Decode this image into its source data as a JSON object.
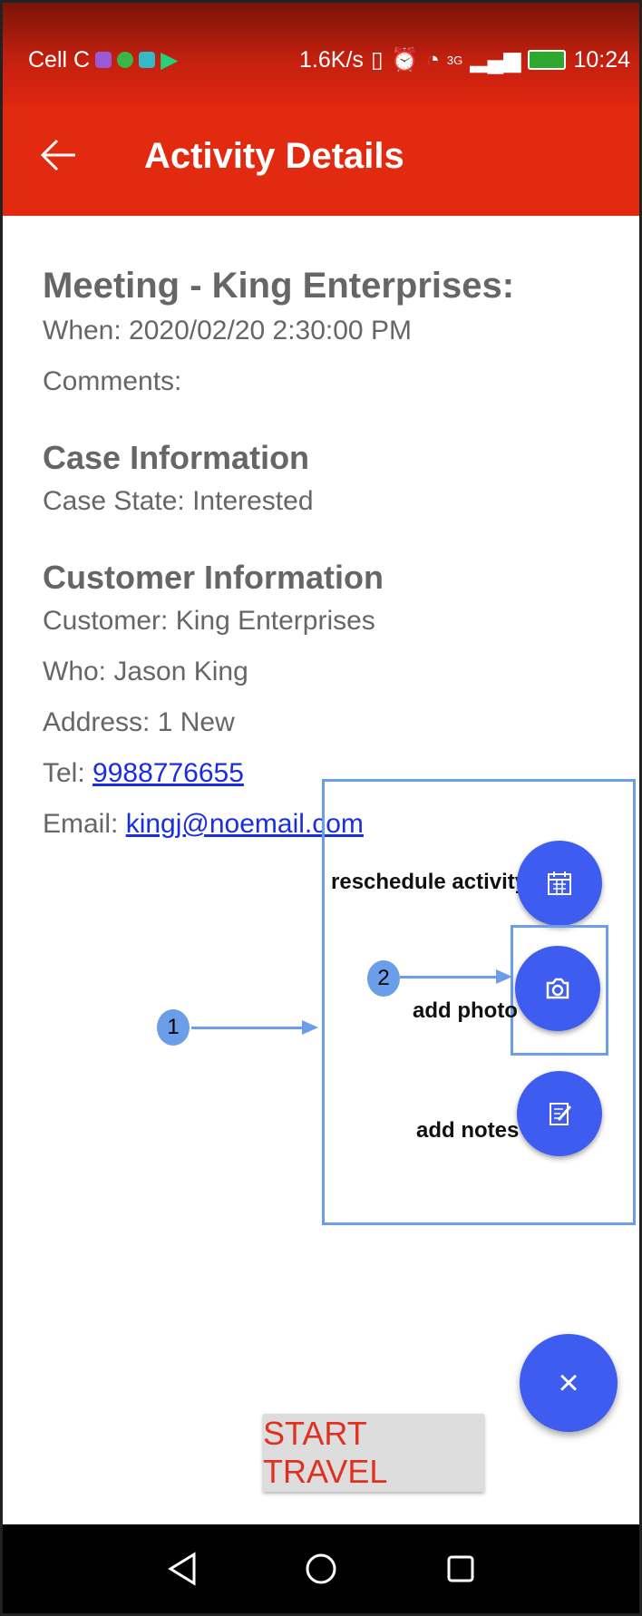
{
  "status_bar": {
    "carrier": "Cell C",
    "speed": "1.6K/s",
    "network": "3G",
    "time": "10:24"
  },
  "app_bar": {
    "title": "Activity Details"
  },
  "activity": {
    "title": "Meeting - King Enterprises:",
    "when": "When: 2020/02/20 2:30:00 PM",
    "comments": "Comments:"
  },
  "case_info": {
    "heading": "Case Information",
    "state": "Case State: Interested"
  },
  "customer_info": {
    "heading": "Customer Information",
    "customer": "Customer: King Enterprises",
    "who": "Who: Jason King",
    "address": "Address: 1 New",
    "tel_label": "Tel:",
    "tel": "9988776655",
    "email_label": "Email:",
    "email": "kingj@noemail.com"
  },
  "fab_menu": {
    "reschedule_label": "reschedule activity",
    "photo_label": "add photo",
    "notes_label": "add notes",
    "close_glyph": "×"
  },
  "annotations": {
    "badge1": "1",
    "badge2": "2"
  },
  "start_travel_label": "START TRAVEL",
  "colors": {
    "status_bar": "#c4200f",
    "app_bar": "#e12a10",
    "fab": "#3f5cf0",
    "callout": "#6b9ee8",
    "link": "#1a2de0",
    "travel_text": "#e03020"
  },
  "icons": [
    "back-arrow-icon",
    "calendar-icon",
    "camera-icon",
    "notes-icon",
    "close-icon",
    "nav-back-icon",
    "nav-home-icon",
    "nav-recents-icon"
  ]
}
